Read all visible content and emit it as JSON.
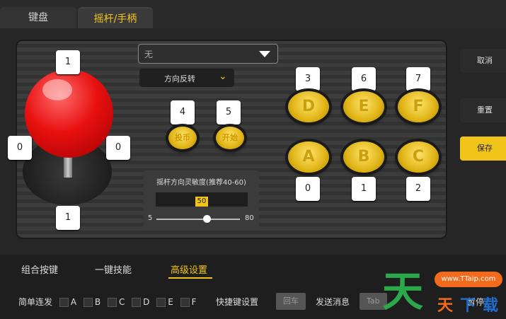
{
  "tabs": [
    {
      "label": "键盘"
    },
    {
      "label": "摇杆/手柄"
    }
  ],
  "joystick": {
    "up": "1",
    "down": "1",
    "left": "0",
    "right": "0"
  },
  "select_value": "无",
  "direction_reverse": "方向反转",
  "small_buttons": [
    {
      "number": "4",
      "label": "投币"
    },
    {
      "number": "5",
      "label": "开始"
    }
  ],
  "big_buttons_top": [
    {
      "number": "3",
      "label": "D"
    },
    {
      "number": "6",
      "label": "E"
    },
    {
      "number": "7",
      "label": "F"
    }
  ],
  "big_buttons_bottom": [
    {
      "number": "0",
      "label": "A"
    },
    {
      "number": "1",
      "label": "B"
    },
    {
      "number": "2",
      "label": "C"
    }
  ],
  "sensitivity": {
    "title": "摇杆方向灵敏度(推荐40-60)",
    "value": "50",
    "min": "5",
    "max": "80"
  },
  "side": {
    "cancel": "取消",
    "reset": "重置",
    "save": "保存"
  },
  "sub_tabs": [
    {
      "label": "组合按键"
    },
    {
      "label": "一键技能"
    },
    {
      "label": "高级设置"
    }
  ],
  "bottom_row": {
    "combo_label": "简单连发",
    "keys": [
      "A",
      "B",
      "C",
      "D",
      "E",
      "F"
    ],
    "shortcut_label": "快捷键设置",
    "enter": "回车",
    "send_msg": "发送消息",
    "tab": "Tab",
    "pause": "暂停"
  },
  "watermark": {
    "url": "www.TTaip.com",
    "big": "天",
    "chars": [
      "天",
      "下",
      "载"
    ]
  },
  "colors": {
    "accent": "#f0c419",
    "red": "#e81010",
    "green": "#2aa84a",
    "orange": "#f26b1d"
  }
}
